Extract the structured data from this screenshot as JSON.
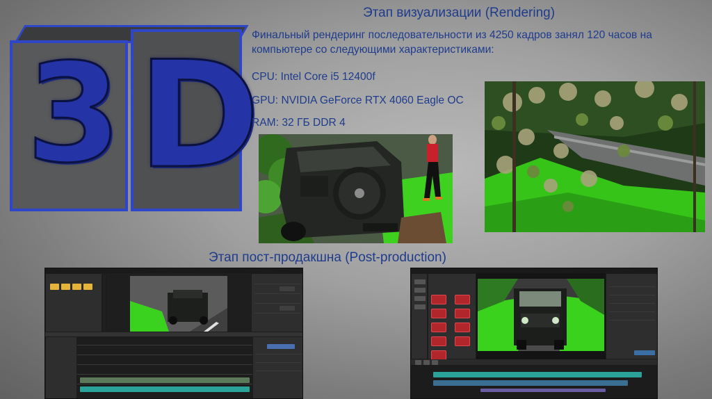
{
  "logo": {
    "char1": "3",
    "char2": "D"
  },
  "rendering": {
    "title": "Этап визуализации (Rendering)",
    "description": "Финальный рендеринг последовательности из 4250 кадров занял 120 часов на компьютере со следующими характеристиками:",
    "cpu": "CPU: Intel Core i5 12400f",
    "gpu": "GPU: NVIDIA GeForce RTX 4060 Eagle OC",
    "ram": "RAM: 32 ГБ DDR 4"
  },
  "post_production": {
    "title": "Этап пост-продакшна (Post-production)"
  },
  "colors": {
    "title_blue": "#1f3c8c",
    "cube_blue": "#2f46c9",
    "chroma_green": "#35d61e",
    "editor_bg": "#262626",
    "clip_teal": "#2aa39a",
    "red_button": "#b0262b"
  },
  "icons": {
    "folder": "folder-icon",
    "play": "play-icon",
    "scissors": "cut-icon"
  }
}
